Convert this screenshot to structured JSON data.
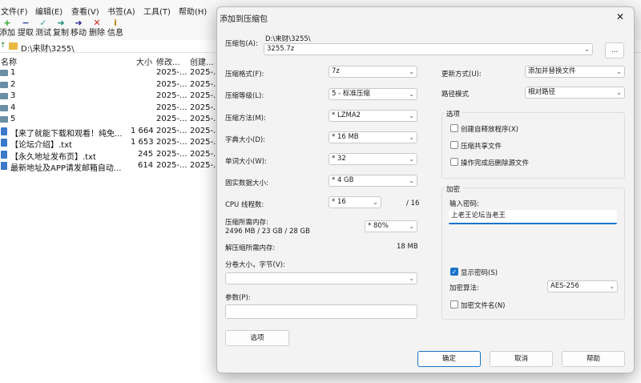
{
  "menu": [
    "文件(F)",
    "编辑(E)",
    "查看(V)",
    "书签(A)",
    "工具(T)",
    "帮助(H)"
  ],
  "toolbar": [
    "添加",
    "提取",
    "测试",
    "复制",
    "移动",
    "删除",
    "信息"
  ],
  "address": {
    "path": "D:\\来财\\3255\\"
  },
  "file_columns": {
    "name": "名称",
    "size": "大小",
    "modified": "修改...",
    "created": "创建..."
  },
  "files": [
    {
      "name": "1",
      "size": "",
      "modified": "2025-...",
      "created": "2025-..."
    },
    {
      "name": "2",
      "size": "",
      "modified": "2025-...",
      "created": "2025-..."
    },
    {
      "name": "3",
      "size": "",
      "modified": "2025-...",
      "created": "2025-..."
    },
    {
      "name": "4",
      "size": "",
      "modified": "2025-...",
      "created": "2025-..."
    },
    {
      "name": "5",
      "size": "",
      "modified": "2025-...",
      "created": "2025-..."
    },
    {
      "name": "【来了就能下载和观看！纯免...",
      "size": "1 664",
      "modified": "2025-...",
      "created": "2025-..."
    },
    {
      "name": "【论坛介绍】.txt",
      "size": "1 653",
      "modified": "2025-...",
      "created": "2025-..."
    },
    {
      "name": "【永久地址发布页】.txt",
      "size": "245",
      "modified": "2025-...",
      "created": "2025-..."
    },
    {
      "name": "最新地址及APP请发邮箱自动...",
      "size": "614",
      "modified": "2025-...",
      "created": "2025-..."
    }
  ],
  "dialog": {
    "title": "添加到压缩包",
    "close": "✕",
    "archive_label": "压缩包(A):",
    "archive_dir": "D:\\来财\\3255\\",
    "archive_name": "3255.7z",
    "browse": "...",
    "format_label": "压缩格式(F):",
    "format_value": "7z",
    "level_label": "压缩等级(L):",
    "level_value": "5 - 标准压缩",
    "method_label": "压缩方法(M):",
    "method_value": "*  LZMA2",
    "dict_label": "字典大小(D):",
    "dict_value": "*  16 MB",
    "word_label": "单词大小(W):",
    "word_value": "*  32",
    "solid_label": "固实数据大小:",
    "solid_value": "*  4 GB",
    "cpu_label": "CPU 线程数:",
    "cpu_value": "*  16",
    "cpu_total": "/ 16",
    "mem_label": "压缩所需内存:",
    "mem_value": "2496 MB / 23 GB / 28 GB",
    "mem_percent": "* 80%",
    "decomp_label": "解压缩所需内存:",
    "decomp_value": "18 MB",
    "split_label": "分卷大小，字节(V):",
    "split_value": "",
    "params_label": "参数(P):",
    "params_value": "",
    "options_button": "选项",
    "update_label": "更新方式(U):",
    "update_value": "添加并替换文件",
    "path_label": "路径模式",
    "path_value": "相对路径",
    "options_group": "选项",
    "opt_sfx": "创建自释放程序(X)",
    "opt_shared": "压缩共享文件",
    "opt_delete": "操作完成后删除源文件",
    "encrypt_group": "加密",
    "password_label": "输入密码:",
    "password_value": "上老王论坛当老王",
    "show_password": "显示密码(S)",
    "enc_method_label": "加密算法:",
    "enc_method_value": "AES-256",
    "enc_names": "加密文件名(N)",
    "ok": "确定",
    "cancel": "取消",
    "help": "帮助"
  },
  "colors": {
    "accent": "#1a73c9",
    "folder": "#6a8ea4",
    "file": "#3a78c8"
  }
}
